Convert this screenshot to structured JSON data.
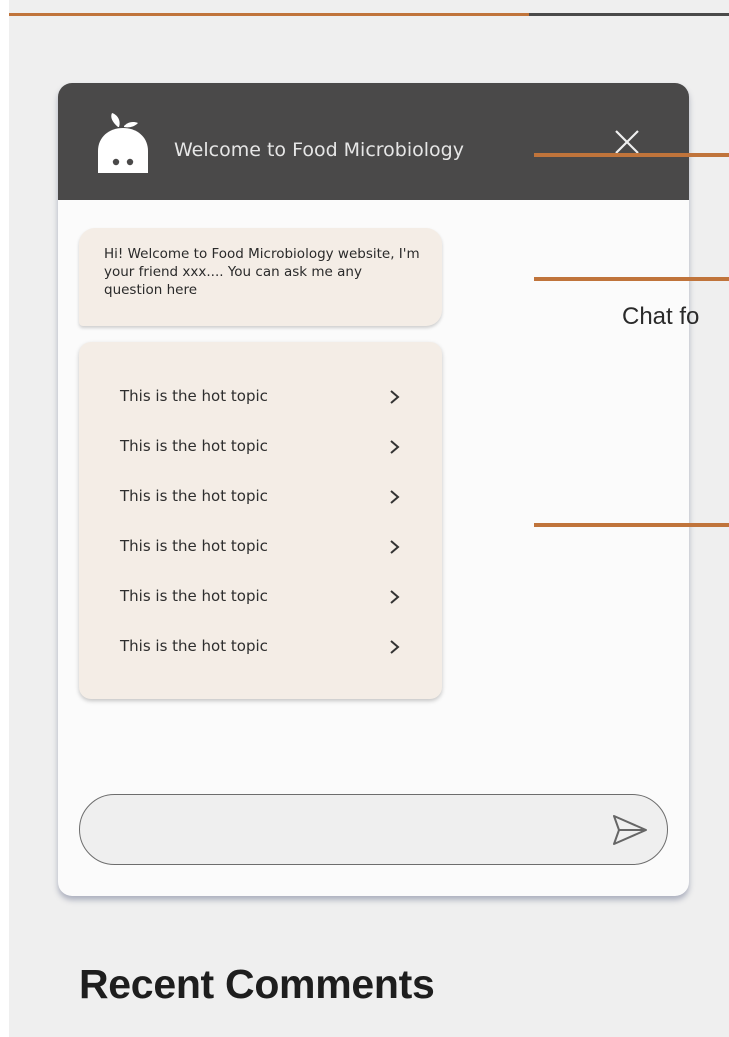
{
  "chat": {
    "title": "Welcome to Food Microbiology",
    "greeting": "Hi! Welcome to Food Microbiology website, I'm your friend xxx.... You can ask me any question here",
    "topics": [
      {
        "label": "This is the hot topic"
      },
      {
        "label": "This is the hot topic"
      },
      {
        "label": "This is the hot topic"
      },
      {
        "label": "This is the hot topic"
      },
      {
        "label": "This is the hot topic"
      },
      {
        "label": "This is the hot topic"
      }
    ],
    "input": {
      "value": "",
      "placeholder": ""
    },
    "icons": {
      "logo": "bot-logo-icon",
      "close": "close-icon",
      "topic_arrow": "chevron-right-icon",
      "send": "send-icon"
    }
  },
  "annotation": {
    "label": "Chat fo"
  },
  "page": {
    "section_heading": "Recent Comments"
  },
  "colors": {
    "accent": "#c0743b",
    "header_bg": "#4a4949",
    "bubble_bg": "#f4ede6",
    "page_bg": "#efefef"
  }
}
